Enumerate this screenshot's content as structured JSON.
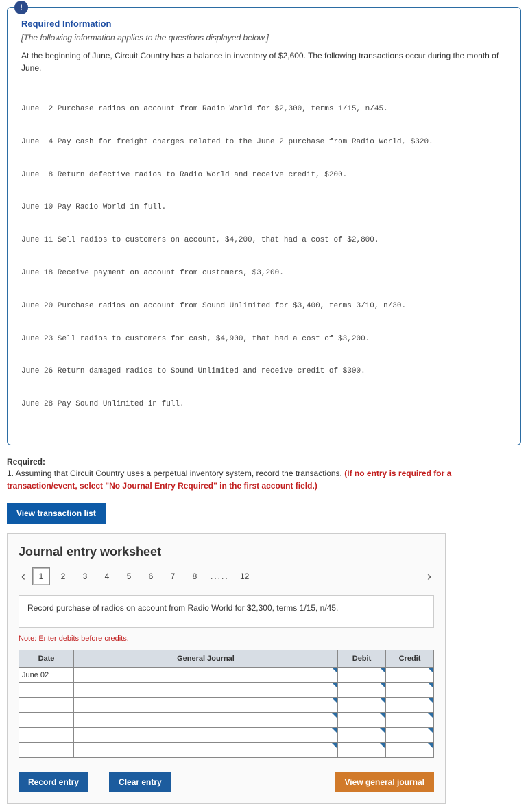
{
  "info": {
    "title": "Required Information",
    "subtitle": "[The following information applies to the questions displayed below.]",
    "intro": "At the beginning of June, Circuit Country has a balance in inventory of $2,600. The following transactions occur during the month of June.",
    "badge": "!",
    "tx": [
      "June  2 Purchase radios on account from Radio World for $2,300, terms 1/15, n/45.",
      "June  4 Pay cash for freight charges related to the June 2 purchase from Radio World, $320.",
      "June  8 Return defective radios to Radio World and receive credit, $200.",
      "June 10 Pay Radio World in full.",
      "June 11 Sell radios to customers on account, $4,200, that had a cost of $2,800.",
      "June 18 Receive payment on account from customers, $3,200.",
      "June 20 Purchase radios on account from Sound Unlimited for $3,400, terms 3/10, n/30.",
      "June 23 Sell radios to customers for cash, $4,900, that had a cost of $3,200.",
      "June 26 Return damaged radios to Sound Unlimited and receive credit of $300.",
      "June 28 Pay Sound Unlimited in full."
    ]
  },
  "required": {
    "label": "Required:",
    "text1": "1. Assuming that Circuit Country uses a perpetual inventory system, record the transactions. ",
    "text2": "(If no entry is required for a transaction/event, select \"No Journal Entry Required\" in the first account field.)"
  },
  "buttons": {
    "view_list": "View transaction list",
    "record": "Record entry",
    "clear": "Clear entry",
    "view_gj": "View general journal"
  },
  "worksheet": {
    "title": "Journal entry worksheet",
    "pages": [
      "1",
      "2",
      "3",
      "4",
      "5",
      "6",
      "7",
      "8"
    ],
    "dots": ".....",
    "last_page": "12",
    "instruction": "Record purchase of radios on account from Radio World for $2,300, terms 1/15, n/45.",
    "note": "Note: Enter debits before credits.",
    "headers": {
      "date": "Date",
      "gj": "General Journal",
      "debit": "Debit",
      "credit": "Credit"
    },
    "date_value": "June 02"
  }
}
